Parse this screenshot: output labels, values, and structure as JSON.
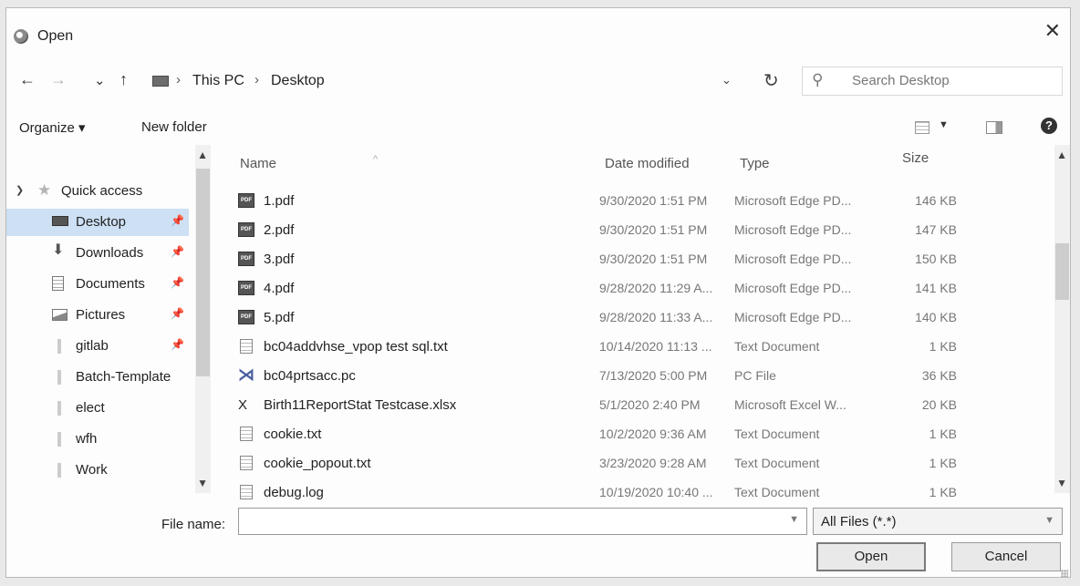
{
  "window": {
    "title": "Open",
    "close_glyph": "✕"
  },
  "nav": {
    "back": "←",
    "forward": "→",
    "recent": "⌄",
    "up": "↑",
    "breadcrumb": [
      "This PC",
      "Desktop"
    ],
    "separator": "›",
    "refresh": "↻",
    "search_placeholder": "Search Desktop"
  },
  "toolbar": {
    "organize": "Organize ▾",
    "new_folder": "New folder",
    "help": "?"
  },
  "sidebar": {
    "quick_access": "Quick access",
    "items": [
      {
        "label": "Desktop",
        "icon": "desktop-icon",
        "pinned": true,
        "selected": true
      },
      {
        "label": "Downloads",
        "icon": "download-icon",
        "pinned": true
      },
      {
        "label": "Documents",
        "icon": "documents-icon",
        "pinned": true
      },
      {
        "label": "Pictures",
        "icon": "pictures-icon",
        "pinned": true
      },
      {
        "label": "gitlab",
        "icon": "folder-icon",
        "pinned": true
      },
      {
        "label": "Batch-Template",
        "icon": "folder-icon"
      },
      {
        "label": "elect",
        "icon": "folder-icon"
      },
      {
        "label": "wfh",
        "icon": "folder-icon"
      },
      {
        "label": "Work",
        "icon": "folder-icon"
      }
    ]
  },
  "columns": {
    "name": "Name",
    "date": "Date modified",
    "type": "Type",
    "size": "Size"
  },
  "files": [
    {
      "name": "1.pdf",
      "date": "9/30/2020 1:51 PM",
      "type": "Microsoft Edge PD...",
      "size": "146 KB",
      "icon": "pdf"
    },
    {
      "name": "2.pdf",
      "date": "9/30/2020 1:51 PM",
      "type": "Microsoft Edge PD...",
      "size": "147 KB",
      "icon": "pdf"
    },
    {
      "name": "3.pdf",
      "date": "9/30/2020 1:51 PM",
      "type": "Microsoft Edge PD...",
      "size": "150 KB",
      "icon": "pdf"
    },
    {
      "name": "4.pdf",
      "date": "9/28/2020 11:29 A...",
      "type": "Microsoft Edge PD...",
      "size": "141 KB",
      "icon": "pdf"
    },
    {
      "name": "5.pdf",
      "date": "9/28/2020 11:33 A...",
      "type": "Microsoft Edge PD...",
      "size": "140 KB",
      "icon": "pdf"
    },
    {
      "name": "bc04addvhse_vpop test sql.txt",
      "date": "10/14/2020 11:13 ...",
      "type": "Text Document",
      "size": "1 KB",
      "icon": "txt"
    },
    {
      "name": "bc04prtsacc.pc",
      "date": "7/13/2020 5:00 PM",
      "type": "PC File",
      "size": "36 KB",
      "icon": "pc"
    },
    {
      "name": "Birth11ReportStat Testcase.xlsx",
      "date": "5/1/2020 2:40 PM",
      "type": "Microsoft Excel W...",
      "size": "20 KB",
      "icon": "xlsx"
    },
    {
      "name": "cookie.txt",
      "date": "10/2/2020 9:36 AM",
      "type": "Text Document",
      "size": "1 KB",
      "icon": "txt"
    },
    {
      "name": "cookie_popout.txt",
      "date": "3/23/2020 9:28 AM",
      "type": "Text Document",
      "size": "1 KB",
      "icon": "txt"
    },
    {
      "name": "debug.log",
      "date": "10/19/2020 10:40 ...",
      "type": "Text Document",
      "size": "1 KB",
      "icon": "txt"
    }
  ],
  "footer": {
    "file_name_label": "File name:",
    "file_name_value": "",
    "filter": "All Files (*.*)",
    "open": "Open",
    "cancel": "Cancel"
  }
}
